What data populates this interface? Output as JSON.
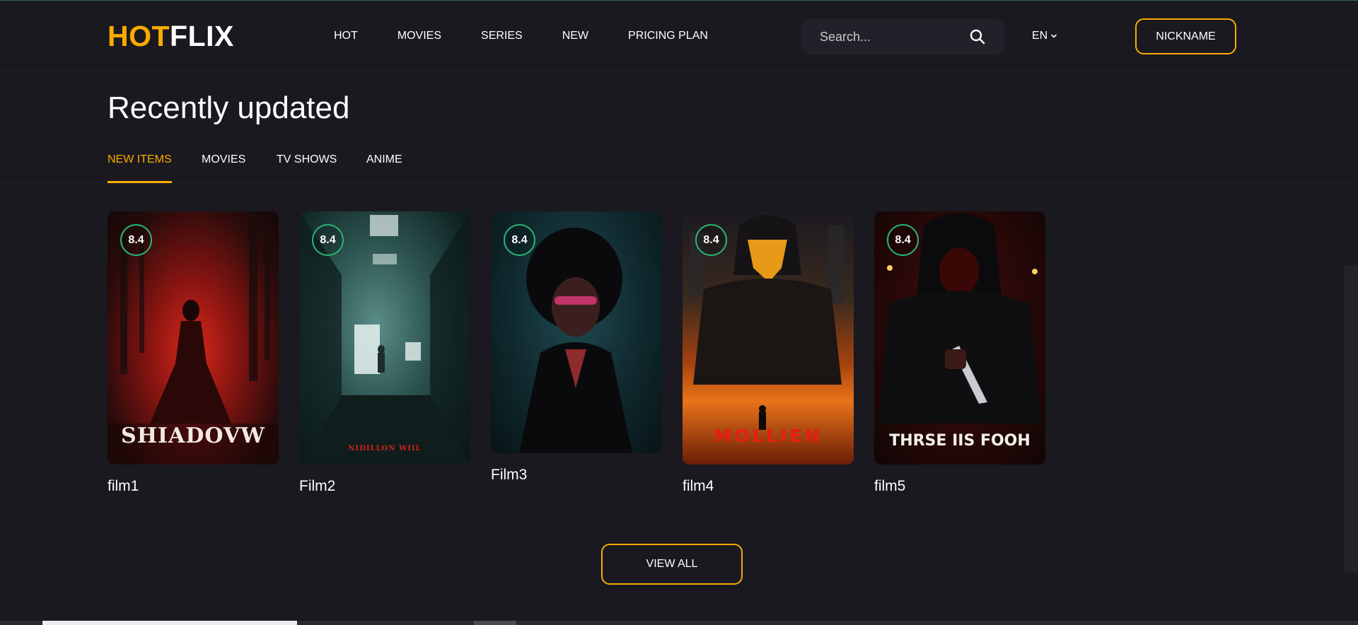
{
  "header": {
    "logo_hot": "HOT",
    "logo_flix": "FLIX",
    "nav": [
      "HOT",
      "MOVIES",
      "SERIES",
      "NEW",
      "PRICING PLAN"
    ],
    "search_placeholder": "Search...",
    "language": "EN",
    "user_button": "NICKNAME"
  },
  "section": {
    "title": "Recently updated",
    "tabs": [
      "NEW ITEMS",
      "MOVIES",
      "TV SHOWS",
      "ANIME"
    ],
    "active_tab": "NEW ITEMS"
  },
  "cards": [
    {
      "title": "film1",
      "rating": "8.4",
      "poster_text": "SHIADOVW"
    },
    {
      "title": "Film2",
      "rating": "8.4",
      "poster_text": "NIDILLON WIIL"
    },
    {
      "title": "Film3",
      "rating": "8.4",
      "poster_text": ""
    },
    {
      "title": "film4",
      "rating": "8.4",
      "poster_text": "MOLLIEN"
    },
    {
      "title": "film5",
      "rating": "8.4",
      "poster_text": "THRSE IIS FOOH"
    }
  ],
  "view_all_label": "VIEW ALL",
  "colors": {
    "accent": "#f9ab00",
    "background": "#1a191f",
    "rating_ring": "#29b474"
  }
}
